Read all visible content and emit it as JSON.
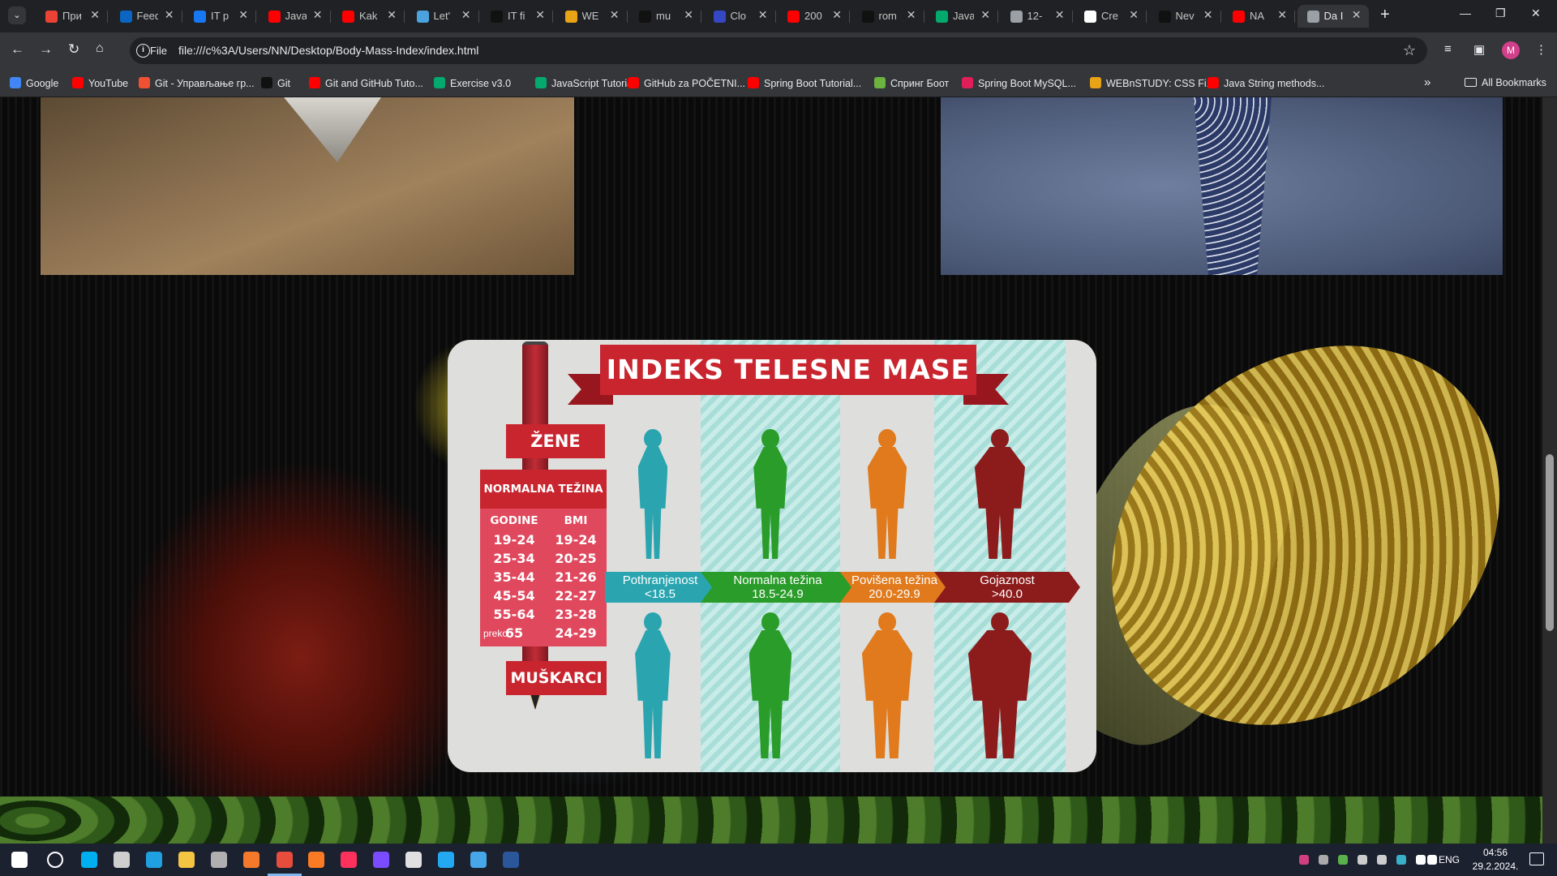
{
  "browser": {
    "tabs": [
      {
        "title": "При",
        "favicon": "gmail-icon",
        "color": "#ea4335"
      },
      {
        "title": "Feed",
        "favicon": "linkedin-icon",
        "color": "#0a66c2"
      },
      {
        "title": "IT p",
        "favicon": "facebook-icon",
        "color": "#1877f2"
      },
      {
        "title": "Java",
        "favicon": "youtube-icon",
        "color": "#ff0000"
      },
      {
        "title": "Kak",
        "favicon": "youtube-icon",
        "color": "#ff0000"
      },
      {
        "title": "Let'",
        "favicon": "globe-icon",
        "color": "#4aa3df"
      },
      {
        "title": "IT fi",
        "favicon": "github-icon",
        "color": "#111111"
      },
      {
        "title": "WE",
        "favicon": "webnstudy-icon",
        "color": "#e8a317"
      },
      {
        "title": "mu",
        "favicon": "github-icon",
        "color": "#111111"
      },
      {
        "title": "Clo",
        "favicon": "cloudinary-icon",
        "color": "#3448c5"
      },
      {
        "title": "200",
        "favicon": "youtube-icon",
        "color": "#ff0000"
      },
      {
        "title": "rom",
        "favicon": "github-icon",
        "color": "#111111"
      },
      {
        "title": "Java",
        "favicon": "w3-icon",
        "color": "#04aa6d"
      },
      {
        "title": "12-",
        "favicon": "globe-icon",
        "color": "#9aa0a6"
      },
      {
        "title": "Cre",
        "favicon": "medium-icon",
        "color": "#ffffff"
      },
      {
        "title": "Nev",
        "favicon": "github-icon",
        "color": "#111111"
      },
      {
        "title": "NA",
        "favicon": "youtube-icon",
        "color": "#ff0000"
      },
      {
        "title": "Da I",
        "favicon": "globe-icon",
        "color": "#9aa0a6",
        "active": true
      }
    ],
    "url_scheme": "File",
    "url": "file:///c%3A/Users/NN/Desktop/Body-Mass-Index/index.html",
    "profile_initial": "M",
    "bookmarks": [
      {
        "label": "Google",
        "icon": "google-icon",
        "color": "#4285f4"
      },
      {
        "label": "YouTube",
        "icon": "youtube-icon",
        "color": "#ff0000"
      },
      {
        "label": "Git - Управљање гр...",
        "icon": "git-icon",
        "color": "#f05133"
      },
      {
        "label": "Git",
        "icon": "github-icon",
        "color": "#111111"
      },
      {
        "label": "Git and GitHub Tuto...",
        "icon": "youtube-icon",
        "color": "#ff0000"
      },
      {
        "label": "Exercise v3.0",
        "icon": "w3-icon",
        "color": "#04aa6d"
      },
      {
        "label": "JavaScript Tutorial",
        "icon": "w3-icon",
        "color": "#04aa6d"
      },
      {
        "label": "GitHub za POČETNI...",
        "icon": "youtube-icon",
        "color": "#ff0000"
      },
      {
        "label": "Spring Boot Tutorial...",
        "icon": "youtube-icon",
        "color": "#ff0000"
      },
      {
        "label": "Спринг Боот",
        "icon": "spring-icon",
        "color": "#6db33f"
      },
      {
        "label": "Spring Boot MySQL...",
        "icon": "slack-icon",
        "color": "#e01e5a"
      },
      {
        "label": "WEBnSTUDY: CSS Fi...",
        "icon": "webnstudy-icon",
        "color": "#e8a317"
      },
      {
        "label": "Java String methods...",
        "icon": "youtube-icon",
        "color": "#ff0000"
      }
    ],
    "all_bookmarks": "All Bookmarks"
  },
  "infographic": {
    "title": "INDEKS TELESNE MASE",
    "women_label": "ŽENE",
    "men_label": "MUŠKARCI",
    "table_title": "NORMALNA TEŽINA",
    "col_age": "GODINE",
    "col_bmi": "BMI",
    "rows": [
      {
        "age": "19-24",
        "bmi": "19-24"
      },
      {
        "age": "25-34",
        "bmi": "20-25"
      },
      {
        "age": "35-44",
        "bmi": "21-26"
      },
      {
        "age": "45-54",
        "bmi": "22-27"
      },
      {
        "age": "55-64",
        "bmi": "23-28"
      },
      {
        "age": "65",
        "bmi": "24-29"
      }
    ],
    "over_prefix": "preko",
    "categories": [
      {
        "name": "Pothranjenost",
        "range": "<18.5",
        "color": "#2aa5b0"
      },
      {
        "name": "Normalna težina",
        "range": "18.5-24.9",
        "color": "#2a9c2a"
      },
      {
        "name": "Povišena težina",
        "range": "20.0-29.9",
        "color": "#e07a1c"
      },
      {
        "name": "Gojaznost",
        "range": ">40.0",
        "color": "#8c1c1c"
      }
    ]
  },
  "taskbar": {
    "language": "ENG",
    "time": "04:56",
    "date": "29.2.2024."
  }
}
